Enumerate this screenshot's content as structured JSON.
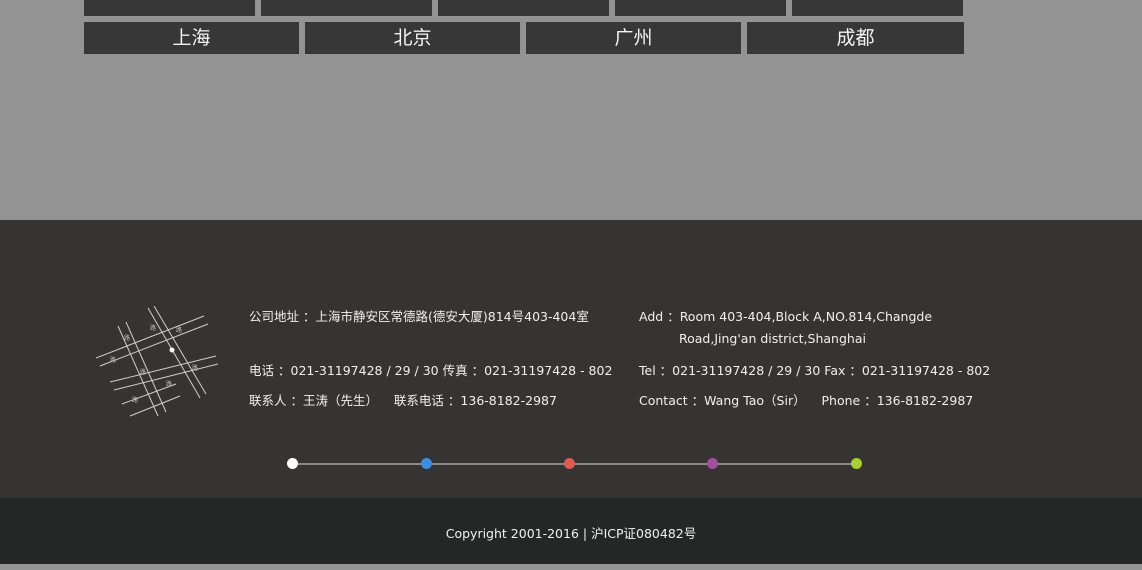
{
  "cities": [
    "上海",
    "北京",
    "广州",
    "成都"
  ],
  "contact_cn": {
    "address_label": "公司地址",
    "address_value": "：上海市静安区常德路(德安大厦)814号403-404室",
    "tel_label": "电话",
    "tel_value": "：021-31197428 / 29 / 30",
    "fax_label": "传真",
    "fax_value": "：021-31197428 - 802",
    "contact_label": "联系人",
    "contact_value": "：王涛（先生）",
    "mobile_label": "联系电话",
    "mobile_value": "：136-8182-2987"
  },
  "contact_en": {
    "add_label": "Add",
    "add_value_1": "：Room 403-404,Block A,NO.814,Changde",
    "add_value_2": "Road,Jing'an district,Shanghai",
    "tel_label": "Tel",
    "tel_value": "：021-31197428 / 29 / 30",
    "fax_label": "Fax",
    "fax_value": "：021-31197428 - 802",
    "contact_label": "Contact",
    "contact_value": "：Wang Tao（Sir）",
    "phone_label": "Phone",
    "phone_value": "：136-8182-2987"
  },
  "dot_colors": [
    "#ffffff",
    "#3a8fe0",
    "#e05a4e",
    "#a44e9e",
    "#a8d12e"
  ],
  "copyright": "Copyright 2001-2016 | 沪ICP证080482号"
}
